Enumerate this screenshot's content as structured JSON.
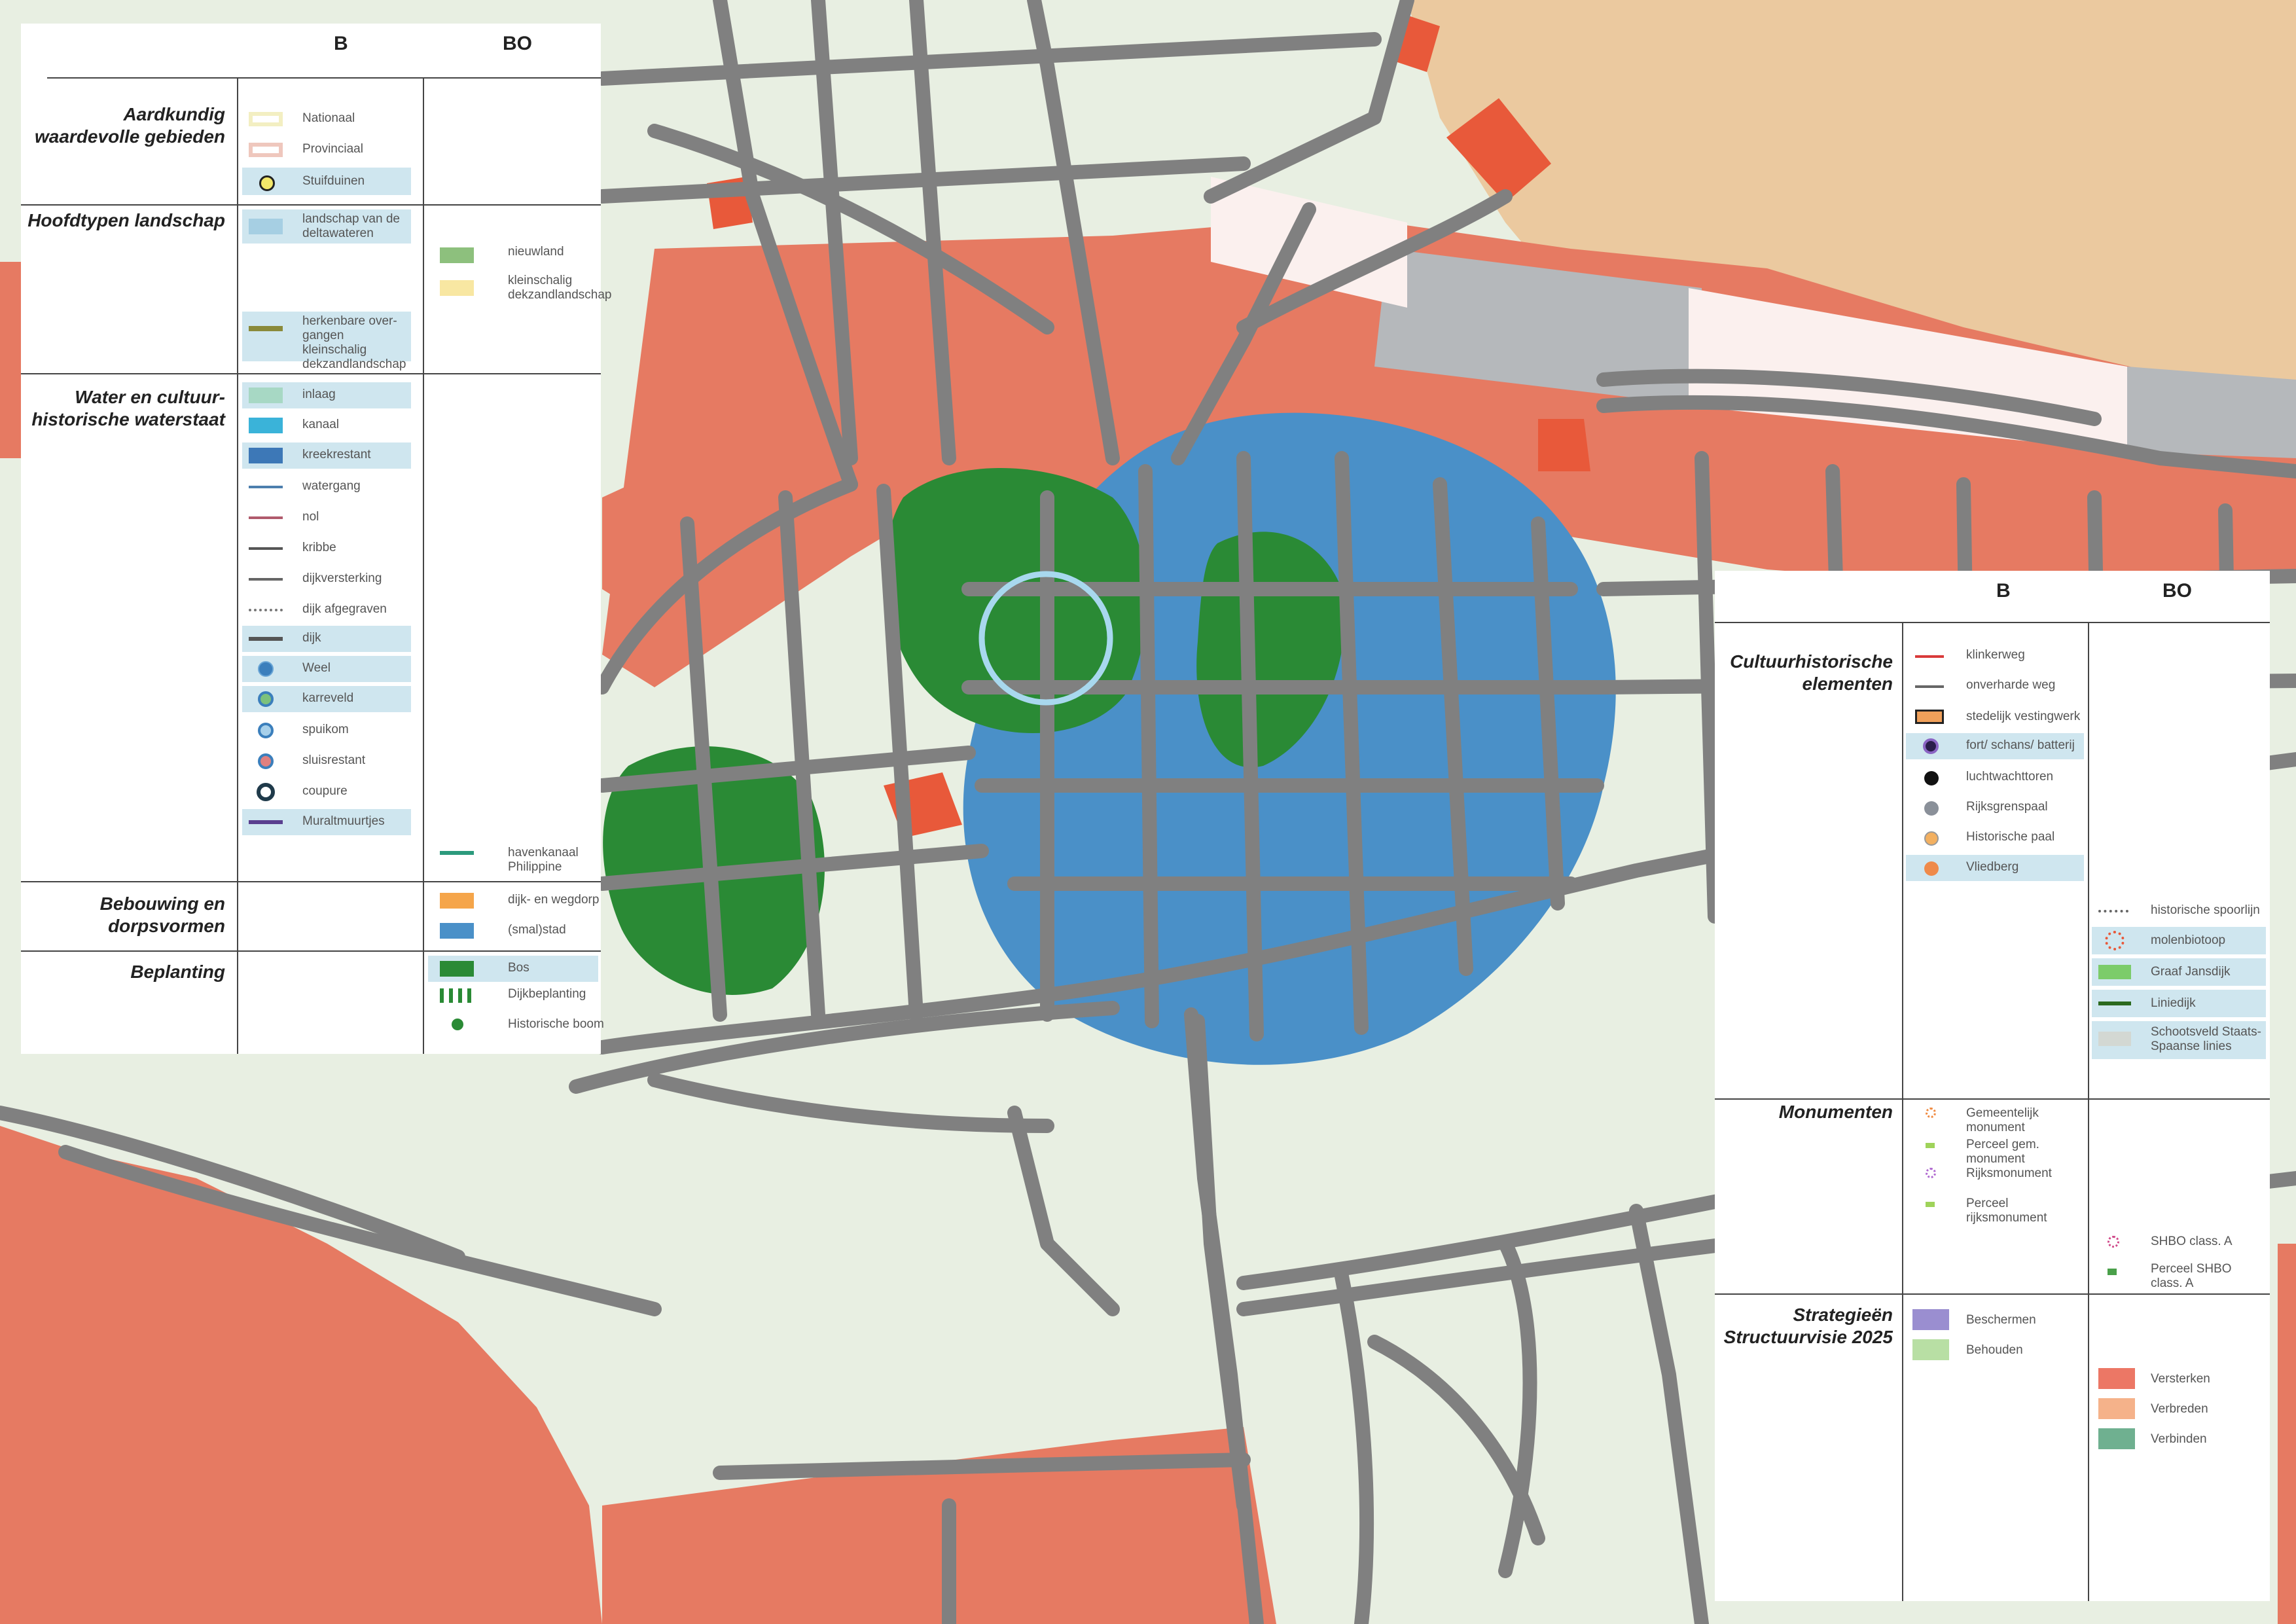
{
  "left_legend": {
    "col_b": "B",
    "col_bo": "BO",
    "sections": {
      "aardkundig": "Aardkundig waardevolle gebieden",
      "hoofdtypen": "Hoofdtypen landschap",
      "water": "Water en cultuur-historische waterstaat",
      "bebouwing": "Bebouwing en dorpsvormen",
      "beplanting": "Beplanting"
    },
    "items": {
      "nationaal": "Nationaal",
      "provinciaal": "Provinciaal",
      "stuifduinen": "Stuifduinen",
      "landschap_deltawateren": "landschap van de deltawateren",
      "herkenbare": "herkenbare over-gangen kleinschalig dekzandlandschap",
      "nieuwland": "nieuwland",
      "kleinschalig": "kleinschalig dekzandlandschap",
      "inlaag": "inlaag",
      "kanaal": "kanaal",
      "kreekrestant": "kreekrestant",
      "watergang": "watergang",
      "nol": "nol",
      "kribbe": "kribbe",
      "dijkversterking": "dijkversterking",
      "dijk_afgegraven": "dijk afgegraven",
      "dijk": "dijk",
      "weel": "Weel",
      "karreveld": "karreveld",
      "spuikom": "spuikom",
      "sluisrestant": "sluisrestant",
      "coupure": "coupure",
      "muraltmuurtjes": "Muraltmuurtjes",
      "havenkanaal": "havenkanaal Philippine",
      "dijk_wegdorp": "dijk- en wegdorp",
      "smal_stad": "(smal)stad",
      "bos": "Bos",
      "dijkbeplanting": "Dijkbeplanting",
      "historische_boom": "Historische boom"
    }
  },
  "right_legend": {
    "col_b": "B",
    "col_bo": "BO",
    "sections": {
      "cultuurhistorische": "Cultuurhistorische elementen",
      "monumenten": "Monumenten",
      "strategieen": "Strategieën Structuurvisie 2025"
    },
    "items": {
      "klinkerweg": "klinkerweg",
      "onverharde_weg": "onverharde weg",
      "stedelijk": "stedelijk vestingwerk",
      "fort": "fort/ schans/ batterij",
      "luchtwachttoren": "luchtwachttoren",
      "rijksgrenspaal": "Rijksgrenspaal",
      "historische_paal": "Historische paal",
      "vliedberg": "Vliedberg",
      "historische_spoorlijn": "historische spoorlijn",
      "molenbiotoop": "molenbiotoop",
      "graaf_jansdijk": "Graaf Jansdijk",
      "liniedijk": "Liniedijk",
      "schootsveld": "Schootsveld Staats-Spaanse linies",
      "gemeentelijk": "Gemeentelijk monument",
      "perceel_gem": "Perceel gem. monument",
      "rijksmonument": "Rijksmonument",
      "perceel_rijks": "Perceel rijksmonument",
      "shbo": "SHBO class. A",
      "perceel_shbo": "Perceel SHBO class. A",
      "beschermen": "Beschermen",
      "behouden": "Behouden",
      "versterken": "Versterken",
      "verbreden": "Verbreden",
      "verbinden": "Verbinden"
    }
  },
  "colors": {
    "background": "#e8efe2",
    "sand": "#ebc99f",
    "salmon": "#e67a62",
    "orange_red": "#e8593a",
    "blue": "#4a90c8",
    "green": "#2a8a35",
    "road": "#808080",
    "grey_block": "#b5b8bb",
    "pink_white": "#fbf0ee",
    "circle": "#a8d8ee"
  }
}
